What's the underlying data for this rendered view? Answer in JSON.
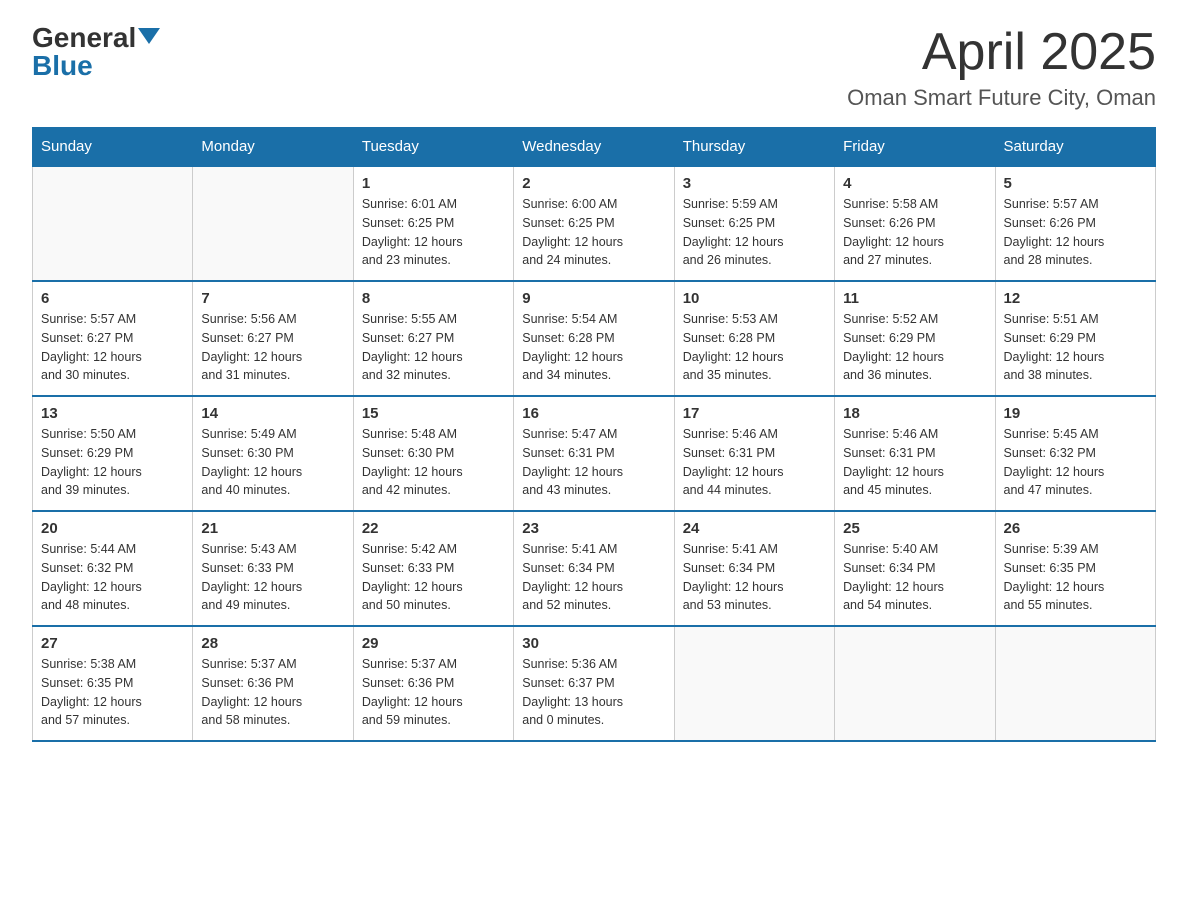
{
  "header": {
    "logo_general": "General",
    "logo_blue": "Blue",
    "title": "April 2025",
    "location": "Oman Smart Future City, Oman"
  },
  "weekdays": [
    "Sunday",
    "Monday",
    "Tuesday",
    "Wednesday",
    "Thursday",
    "Friday",
    "Saturday"
  ],
  "weeks": [
    [
      {
        "day": "",
        "info": ""
      },
      {
        "day": "",
        "info": ""
      },
      {
        "day": "1",
        "info": "Sunrise: 6:01 AM\nSunset: 6:25 PM\nDaylight: 12 hours\nand 23 minutes."
      },
      {
        "day": "2",
        "info": "Sunrise: 6:00 AM\nSunset: 6:25 PM\nDaylight: 12 hours\nand 24 minutes."
      },
      {
        "day": "3",
        "info": "Sunrise: 5:59 AM\nSunset: 6:25 PM\nDaylight: 12 hours\nand 26 minutes."
      },
      {
        "day": "4",
        "info": "Sunrise: 5:58 AM\nSunset: 6:26 PM\nDaylight: 12 hours\nand 27 minutes."
      },
      {
        "day": "5",
        "info": "Sunrise: 5:57 AM\nSunset: 6:26 PM\nDaylight: 12 hours\nand 28 minutes."
      }
    ],
    [
      {
        "day": "6",
        "info": "Sunrise: 5:57 AM\nSunset: 6:27 PM\nDaylight: 12 hours\nand 30 minutes."
      },
      {
        "day": "7",
        "info": "Sunrise: 5:56 AM\nSunset: 6:27 PM\nDaylight: 12 hours\nand 31 minutes."
      },
      {
        "day": "8",
        "info": "Sunrise: 5:55 AM\nSunset: 6:27 PM\nDaylight: 12 hours\nand 32 minutes."
      },
      {
        "day": "9",
        "info": "Sunrise: 5:54 AM\nSunset: 6:28 PM\nDaylight: 12 hours\nand 34 minutes."
      },
      {
        "day": "10",
        "info": "Sunrise: 5:53 AM\nSunset: 6:28 PM\nDaylight: 12 hours\nand 35 minutes."
      },
      {
        "day": "11",
        "info": "Sunrise: 5:52 AM\nSunset: 6:29 PM\nDaylight: 12 hours\nand 36 minutes."
      },
      {
        "day": "12",
        "info": "Sunrise: 5:51 AM\nSunset: 6:29 PM\nDaylight: 12 hours\nand 38 minutes."
      }
    ],
    [
      {
        "day": "13",
        "info": "Sunrise: 5:50 AM\nSunset: 6:29 PM\nDaylight: 12 hours\nand 39 minutes."
      },
      {
        "day": "14",
        "info": "Sunrise: 5:49 AM\nSunset: 6:30 PM\nDaylight: 12 hours\nand 40 minutes."
      },
      {
        "day": "15",
        "info": "Sunrise: 5:48 AM\nSunset: 6:30 PM\nDaylight: 12 hours\nand 42 minutes."
      },
      {
        "day": "16",
        "info": "Sunrise: 5:47 AM\nSunset: 6:31 PM\nDaylight: 12 hours\nand 43 minutes."
      },
      {
        "day": "17",
        "info": "Sunrise: 5:46 AM\nSunset: 6:31 PM\nDaylight: 12 hours\nand 44 minutes."
      },
      {
        "day": "18",
        "info": "Sunrise: 5:46 AM\nSunset: 6:31 PM\nDaylight: 12 hours\nand 45 minutes."
      },
      {
        "day": "19",
        "info": "Sunrise: 5:45 AM\nSunset: 6:32 PM\nDaylight: 12 hours\nand 47 minutes."
      }
    ],
    [
      {
        "day": "20",
        "info": "Sunrise: 5:44 AM\nSunset: 6:32 PM\nDaylight: 12 hours\nand 48 minutes."
      },
      {
        "day": "21",
        "info": "Sunrise: 5:43 AM\nSunset: 6:33 PM\nDaylight: 12 hours\nand 49 minutes."
      },
      {
        "day": "22",
        "info": "Sunrise: 5:42 AM\nSunset: 6:33 PM\nDaylight: 12 hours\nand 50 minutes."
      },
      {
        "day": "23",
        "info": "Sunrise: 5:41 AM\nSunset: 6:34 PM\nDaylight: 12 hours\nand 52 minutes."
      },
      {
        "day": "24",
        "info": "Sunrise: 5:41 AM\nSunset: 6:34 PM\nDaylight: 12 hours\nand 53 minutes."
      },
      {
        "day": "25",
        "info": "Sunrise: 5:40 AM\nSunset: 6:34 PM\nDaylight: 12 hours\nand 54 minutes."
      },
      {
        "day": "26",
        "info": "Sunrise: 5:39 AM\nSunset: 6:35 PM\nDaylight: 12 hours\nand 55 minutes."
      }
    ],
    [
      {
        "day": "27",
        "info": "Sunrise: 5:38 AM\nSunset: 6:35 PM\nDaylight: 12 hours\nand 57 minutes."
      },
      {
        "day": "28",
        "info": "Sunrise: 5:37 AM\nSunset: 6:36 PM\nDaylight: 12 hours\nand 58 minutes."
      },
      {
        "day": "29",
        "info": "Sunrise: 5:37 AM\nSunset: 6:36 PM\nDaylight: 12 hours\nand 59 minutes."
      },
      {
        "day": "30",
        "info": "Sunrise: 5:36 AM\nSunset: 6:37 PM\nDaylight: 13 hours\nand 0 minutes."
      },
      {
        "day": "",
        "info": ""
      },
      {
        "day": "",
        "info": ""
      },
      {
        "day": "",
        "info": ""
      }
    ]
  ]
}
